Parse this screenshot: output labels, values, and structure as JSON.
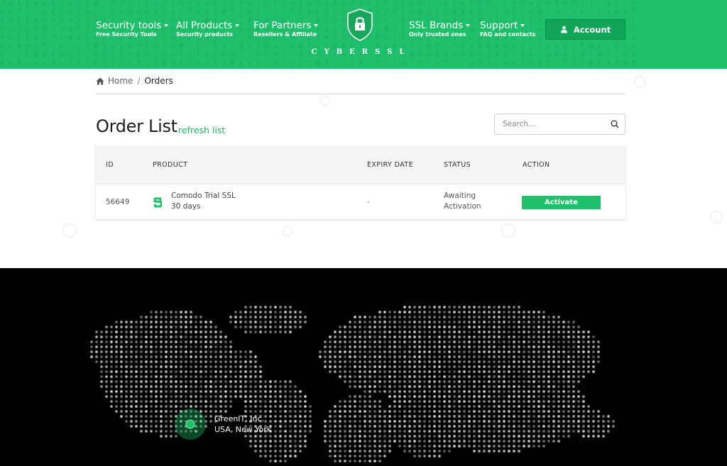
{
  "colors": {
    "brand_green": "#1fbf6b",
    "account_button": "#11a558",
    "footer_background": "#000000"
  },
  "header": {
    "nav_left": [
      {
        "title": "Security tools",
        "subtitle": "Free Security Tools"
      },
      {
        "title": "All Products",
        "subtitle": "Security products"
      },
      {
        "title": "For Partners",
        "subtitle": "Resellers & Affiliate"
      }
    ],
    "nav_right": [
      {
        "title": "SSL Brands",
        "subtitle": "Only trusted ones"
      },
      {
        "title": "Support",
        "subtitle": "FAQ and contacts"
      }
    ],
    "logo_text": "CYBERSSL",
    "logo_icon": "shield-lock-icon",
    "account_label": "Account",
    "account_icon": "user-icon"
  },
  "breadcrumb": {
    "home_icon": "home-icon",
    "home": "Home",
    "separator": "/",
    "current": "Orders"
  },
  "main": {
    "title": "Order List",
    "refresh_label": "refresh list",
    "search_placeholder": "Search...",
    "search_icon": "search-icon"
  },
  "table": {
    "columns": [
      "ID",
      "PRODUCT",
      "EXPIRY DATE",
      "STATUS",
      "ACTION"
    ],
    "rows": [
      {
        "id": "56649",
        "product_icon": "sectigo-s-icon",
        "product_name": "Comodo Trial SSL",
        "product_term": "30 days",
        "expiry": "-",
        "status_line1": "Awaiting",
        "status_line2": "Activation",
        "action_label": "Activate"
      }
    ]
  },
  "footer": {
    "location_company": "GreenIT, Inc.",
    "location_place": "USA, New York",
    "map_icon": "world-dot-map"
  }
}
